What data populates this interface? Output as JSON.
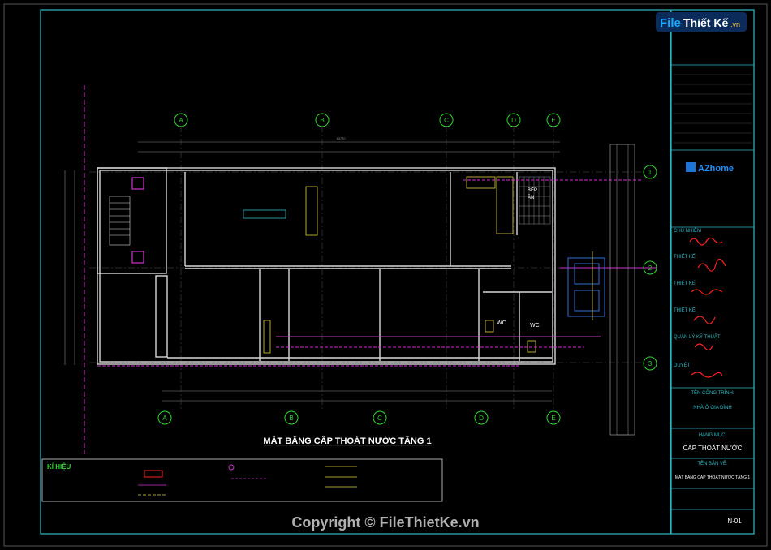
{
  "watermark": {
    "brand_file": "File",
    "brand_rest": "Thiết Kế",
    "brand_tld": ".vn",
    "copyright": "Copyright © FileThietKe.vn"
  },
  "plan": {
    "title": "MẶT BẰNG CẤP THOÁT NƯỚC TẦNG 1",
    "grid_letters": [
      "A",
      "B",
      "C",
      "D",
      "E"
    ],
    "grid_numbers": [
      "1",
      "2",
      "3"
    ],
    "room_labels": {
      "wc1": "WC",
      "wc2": "WC",
      "kitchen": "BẾP\nĂN"
    },
    "legend_title": "KÍ HIỆU"
  },
  "title_block": {
    "owner_label": "CHỦ NHIỆM",
    "designer_label": "THIẾT KẾ",
    "drafter_label": "THIẾT KẾ",
    "checker_label": "THIẾT KẾ",
    "qa_label": "QUẢN LÝ KỸ THUẬT",
    "approval_label": "DUYỆT",
    "project_label": "TÊN CÔNG TRÌNH:",
    "project_name": "NHÀ Ở GIA ĐÌNH",
    "category_label": "HẠNG MỤC:",
    "category_value": "CẤP THOÁT NƯỚC",
    "drawing_label": "TÊN BẢN VẼ:",
    "drawing_value": "MẶT BẰNG CẤP THOÁT NƯỚC TẦNG 1",
    "sheet_no": "N-01",
    "logo_text": "AZhome"
  },
  "colors": {
    "bg": "#000000",
    "frame": "#2fb9c4",
    "wall": "#d8d8d8",
    "axis": "#cc33cc",
    "grid_circle": "#31d631",
    "accent_yellow": "#e0d040",
    "sig_red": "#ff2222"
  }
}
